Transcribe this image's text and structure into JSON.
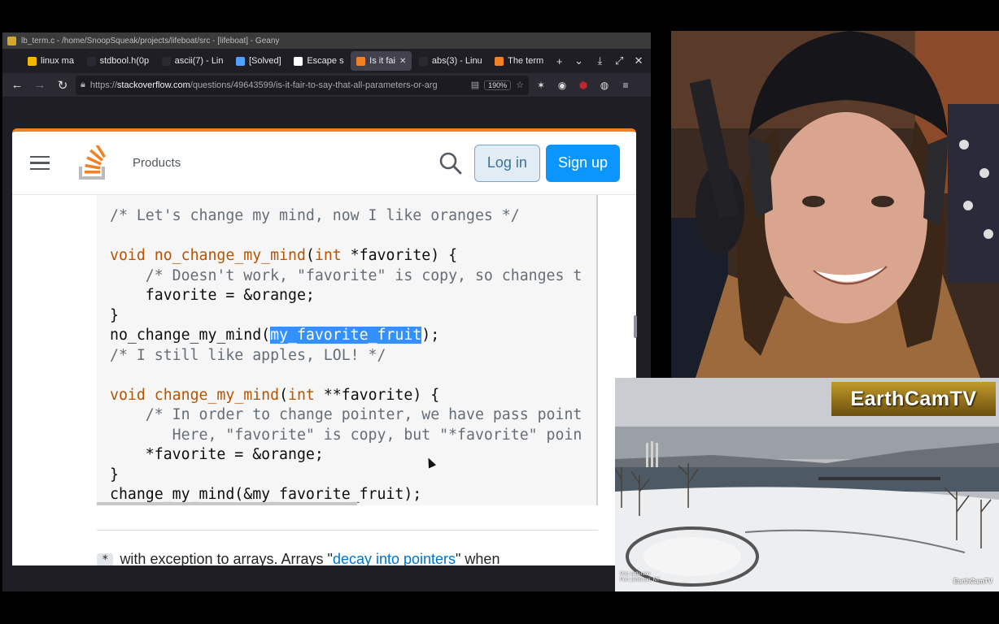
{
  "window": {
    "title": "lb_term.c - /home/SnoopSqueak/projects/lifeboat/src - [lifeboat] - Geany"
  },
  "tabs": [
    {
      "label": "linux ma",
      "color": "#f2b600"
    },
    {
      "label": "stdbool.h(0p",
      "color": "#2b2a33"
    },
    {
      "label": "ascii(7) - Lin",
      "color": "#2b2a33"
    },
    {
      "label": "[Solved]",
      "color": "#4ea1ff"
    },
    {
      "label": "Escape s",
      "color": "#ffffff"
    },
    {
      "label": "Is it fai",
      "color": "#f48024",
      "active": true
    },
    {
      "label": "abs(3) - Linu",
      "color": "#2b2a33"
    },
    {
      "label": "The term",
      "color": "#f48024"
    }
  ],
  "toolbar": {
    "new_tab": "+",
    "list_tabs": "⌄",
    "download": "⤓",
    "fullscreen": "⤢",
    "close": "✕"
  },
  "nav": {
    "url_prefix": "https://",
    "url_host": "stackoverflow.com",
    "url_path": "/questions/49643599/is-it-fair-to-say-that-all-parameters-or-arg",
    "zoom": "190%"
  },
  "so": {
    "products": "Products",
    "login": "Log in",
    "signup": "Sign up"
  },
  "code": {
    "l1": "/* Let's change my mind, now I like oranges */",
    "l3_kw": "void",
    "l3_fn": "no_change_my_mind",
    "l3_p1": "(",
    "l3_int": "int",
    "l3_rest": " *favorite) {",
    "l4": "    /* Doesn't work, \"favorite\" is copy, so changes t",
    "l5": "    favorite = &orange;",
    "l6": "}",
    "l7_a": "no_change_my_mind(",
    "l7_sel": "my_favorite_fruit",
    "l7_b": ");",
    "l8": "/* I still like apples, LOL! */",
    "l10_kw": "void",
    "l10_fn": "change_my_mind",
    "l10_p1": "(",
    "l10_int": "int",
    "l10_rest": " **favorite) {",
    "l11": "    /* In order to change pointer, we have pass point",
    "l12": "       Here, \"favorite\" is copy, but \"*favorite\" poin",
    "l13": "    *favorite = &orange;",
    "l14": "}",
    "l15": "change_my_mind(&my_favorite_fruit);"
  },
  "footnote": {
    "star": "*",
    "text": "with exception to arrays. Arrays \"",
    "link": "decay into pointers",
    "after": "\" when"
  },
  "earthcam": {
    "brand": "EarthCamTV",
    "watermark": "EarthCamTV",
    "location_line1": "Port Jefferson",
    "location_line2": "Port Jefferson, NY"
  }
}
